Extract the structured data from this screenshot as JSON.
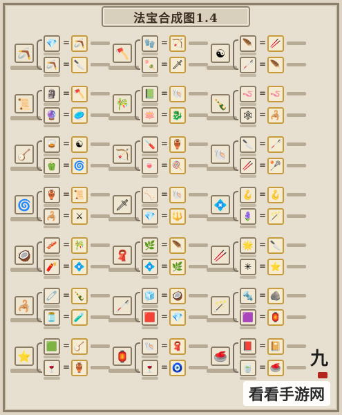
{
  "title": "法宝合成图1.4",
  "watermark": "看看手游网",
  "seal_text": "九",
  "colors": {
    "background": "#e7e0d1",
    "frame": "#8c7f6c",
    "result_border": "#c79a3c"
  },
  "recipe_icons": [
    [
      "🪃",
      "🔪",
      "🏹",
      "🗡",
      "🥢",
      "🪶"
    ],
    [
      "🪓",
      "🥏",
      "🐚",
      "🐉",
      "🪱",
      "🦂"
    ],
    [
      "☯",
      "🌀",
      "🏺",
      "🍭",
      "🦯",
      "🥍"
    ],
    [
      "📜",
      "⚔",
      "🐚",
      "🔱",
      "🪝",
      "🪄"
    ],
    [
      "🎋",
      "💠",
      "🪶",
      "🌿",
      "🔪",
      "⭐"
    ],
    [
      "🍾",
      "🧪",
      "🥥",
      "💎",
      "🪨",
      "🏮"
    ],
    [
      "🪕",
      "🏺",
      "🧣",
      "🧿",
      "📔",
      "🥌"
    ]
  ],
  "ingredient_icons": [
    [
      "💎",
      "🪃",
      "🧤",
      "🍡",
      "🪶",
      "🦯"
    ],
    [
      "🗿",
      "🔮",
      "📗",
      "🪷",
      "🪱",
      "🕸"
    ],
    [
      "🥃",
      "🫑",
      "🪛",
      "🍬",
      "🔪",
      "🥢"
    ],
    [
      "🏺",
      "🦂",
      "🦴",
      "💎",
      "🪝",
      "🪻"
    ],
    [
      "🥓",
      "🧨",
      "🌿",
      "💠",
      "🌟",
      "✳"
    ],
    [
      "🧷",
      "🫙",
      "🧊",
      "🟥",
      "🔩",
      "🟪"
    ],
    [
      "🟩",
      "🍷",
      "🐚",
      "🍷",
      "📕",
      "🍵"
    ]
  ]
}
